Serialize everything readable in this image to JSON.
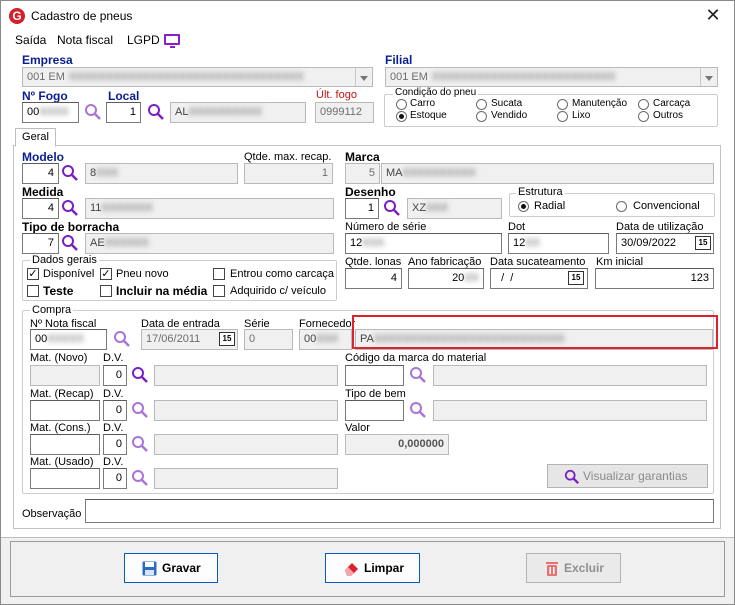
{
  "window": {
    "title": "Cadastro de pneus",
    "logo": "G",
    "close": "✕"
  },
  "menu": {
    "items": [
      "Saída",
      "Nota fiscal",
      "LGPD"
    ]
  },
  "header": {
    "empresa_label": "Empresa",
    "empresa_value": "001 EM",
    "filial_label": "Filial",
    "filial_value": "001 EM",
    "nfogo_label": "Nº  Fogo",
    "nfogo_value": "00",
    "local_label": "Local",
    "local_value": "1",
    "local_desc": "AL",
    "ultfogo_label": "Últ. fogo",
    "ultfogo_value": "0999112",
    "condicao_title": "Condição do pneu",
    "condicao_options": [
      "Carro",
      "Sucata",
      "Manutenção",
      "Carcaça",
      "Estoque",
      "Vendido",
      "Lixo",
      "Outros"
    ],
    "condicao_selected": "Estoque"
  },
  "tabs": [
    "Geral"
  ],
  "geral": {
    "modelo_label": "Modelo",
    "modelo_code": "4",
    "modelo_desc": "8",
    "qtde_max_label": "Qtde. max. recap.",
    "qtde_max_value": "1",
    "marca_label": "Marca",
    "marca_code": "5",
    "marca_desc": "MA",
    "medida_label": "Medida",
    "medida_code": "4",
    "medida_desc": "11",
    "desenho_label": "Desenho",
    "desenho_code": "1",
    "desenho_desc": "XZ",
    "estrutura_title": "Estrutura",
    "estrutura_options": [
      "Radial",
      "Convencional"
    ],
    "estrutura_selected": "Radial",
    "tipo_borracha_label": "Tipo de borracha",
    "tipo_borracha_code": "7",
    "tipo_borracha_desc": "AE",
    "num_serie_label": "Número de série",
    "num_serie_value": "12",
    "dot_label": "Dot",
    "dot_value": "12",
    "data_util_label": "Data de utilização",
    "data_util_value": "30/09/2022",
    "dados_title": "Dados gerais",
    "chk_disponivel": "Disponível",
    "chk_pneu_novo": "Pneu novo",
    "chk_entrou": "Entrou como carcaça",
    "chk_teste": "Teste",
    "chk_incluir": "Incluir na média",
    "chk_adquirido": "Adquirido c/ veículo",
    "qtde_lonas_label": "Qtde. lonas",
    "qtde_lonas_value": "4",
    "ano_fab_label": "Ano fabricação",
    "ano_fab_value": "20",
    "data_suc_label": "Data sucateamento",
    "data_suc_value": "  /  /",
    "km_label": "Km inicial",
    "km_value": "123",
    "cal_icon_text": "15"
  },
  "compra": {
    "title": "Compra",
    "nota_label": "Nº Nota fiscal",
    "nota_value": "00",
    "data_entrada_label": "Data de entrada",
    "data_entrada_value": "17/06/2011",
    "serie_label": "Série",
    "serie_value": "0",
    "fornecedor_label": "Fornecedor",
    "fornecedor_code": "00",
    "fornecedor_desc": "PA",
    "mat_novo_label": "Mat. (Novo)",
    "mat_recap_label": "Mat. (Recap)",
    "mat_cons_label": "Mat. (Cons.)",
    "mat_usado_label": "Mat. (Usado)",
    "dv_label": "D.V.",
    "dv_value": "0",
    "cod_marca_label": "Código da marca do material",
    "tipo_bem_label": "Tipo de bem",
    "valor_label": "Valor",
    "valor_value": "0,000000",
    "garantias_label": "Visualizar garantias"
  },
  "observacao_label": "Observação",
  "buttons": {
    "gravar": "Gravar",
    "limpar": "Limpar",
    "excluir": "Excluir"
  },
  "colors": {
    "accent_blue": "#0a1f8f",
    "magnifier": "#7a1fc2",
    "highlight": "#e0202a"
  }
}
